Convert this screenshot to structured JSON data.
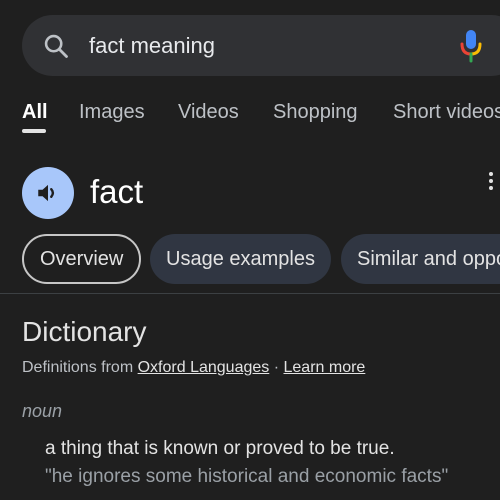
{
  "search": {
    "query": "fact meaning"
  },
  "tabs": [
    {
      "label": "All"
    },
    {
      "label": "Images"
    },
    {
      "label": "Videos"
    },
    {
      "label": "Shopping"
    },
    {
      "label": "Short videos"
    }
  ],
  "word": {
    "headword": "fact"
  },
  "chips": [
    {
      "label": "Overview"
    },
    {
      "label": "Usage examples"
    },
    {
      "label": "Similar and opposite words"
    }
  ],
  "dictionary": {
    "title": "Dictionary",
    "source_prefix": "Definitions from",
    "source_link": "Oxford Languages",
    "separator": "·",
    "learn_more": "Learn more",
    "part_of_speech": "noun",
    "definition": "a thing that is known or proved to be true.",
    "example": "\"he ignores some historical and economic facts\""
  },
  "colors": {
    "background": "#1f1f1f",
    "search_bar": "#303134",
    "speaker_button": "#a8c7fa",
    "chip": "#303642"
  }
}
